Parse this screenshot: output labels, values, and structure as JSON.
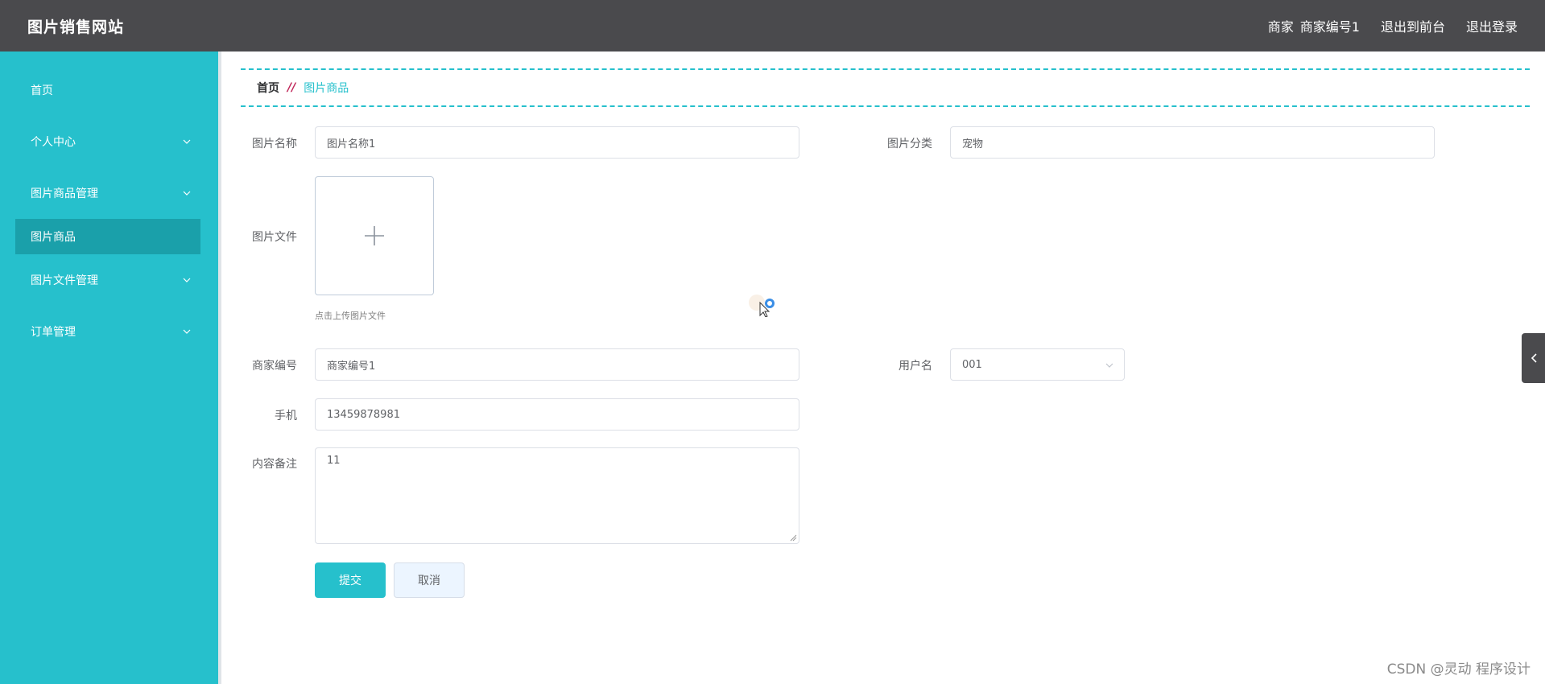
{
  "header": {
    "title": "图片销售网站",
    "role": "商家",
    "username": "商家编号1",
    "back_to_front": "退出到前台",
    "logout": "退出登录"
  },
  "sidebar": {
    "items": [
      {
        "label": "首页",
        "has_children": false
      },
      {
        "label": "个人中心",
        "has_children": true
      },
      {
        "label": "图片商品管理",
        "has_children": true
      },
      {
        "label": "图片商品",
        "has_children": false,
        "active": true
      },
      {
        "label": "图片文件管理",
        "has_children": true
      },
      {
        "label": "订单管理",
        "has_children": true
      }
    ]
  },
  "breadcrumb": {
    "home": "首页",
    "separator": "//",
    "current": "图片商品"
  },
  "form": {
    "name_label": "图片名称",
    "name_value": "图片名称1",
    "category_label": "图片分类",
    "category_value": "宠物",
    "file_label": "图片文件",
    "upload_tip": "点击上传图片文件",
    "merchant_label": "商家编号",
    "merchant_value": "商家编号1",
    "username_label": "用户名",
    "username_value": "001",
    "phone_label": "手机",
    "phone_value": "13459878981",
    "remark_label": "内容备注",
    "remark_value": "11",
    "submit": "提交",
    "cancel": "取消"
  },
  "watermark": "CSDN @灵动 程序设计",
  "colors": {
    "header_bg": "#4a4a4d",
    "sidebar_bg": "#26c0cc",
    "sidebar_active": "#1aa0aa",
    "accent": "#26c0cc",
    "breadcrumb_sep": "#c0285a"
  }
}
